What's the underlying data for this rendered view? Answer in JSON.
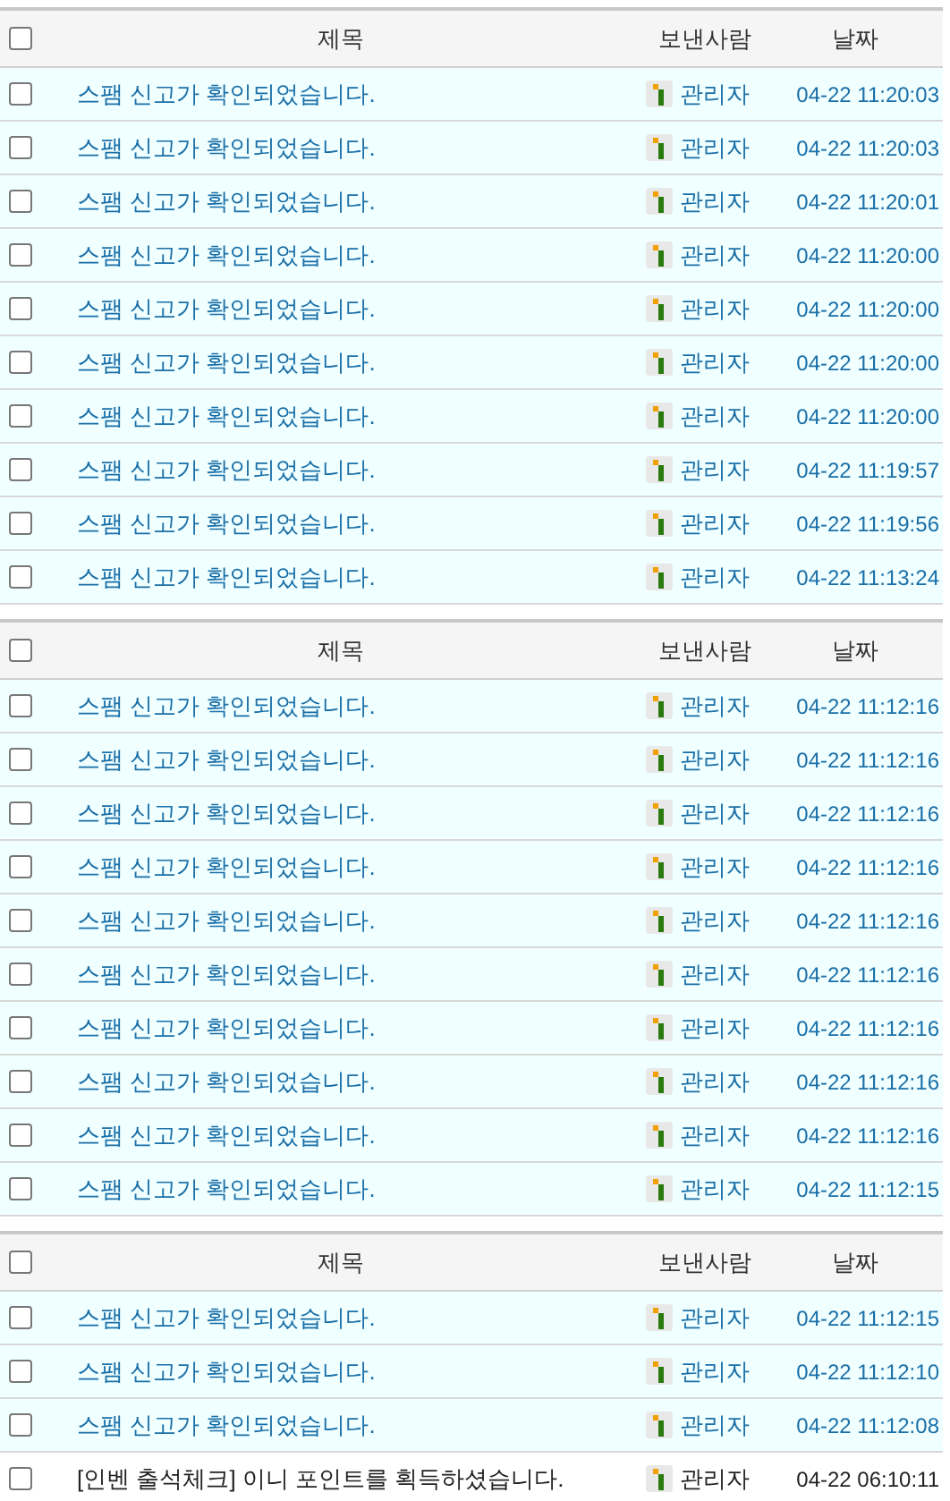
{
  "tables": [
    {
      "all_checked": false,
      "columns": [
        "제목",
        "보낸사람",
        "날짜"
      ],
      "rows": [
        {
          "subject": "스팸 신고가 확인되었습니다.",
          "sender": "관리자",
          "date": "04-22 11:20:03",
          "unread": true,
          "checked": false
        },
        {
          "subject": "스팸 신고가 확인되었습니다.",
          "sender": "관리자",
          "date": "04-22 11:20:03",
          "unread": true,
          "checked": false
        },
        {
          "subject": "스팸 신고가 확인되었습니다.",
          "sender": "관리자",
          "date": "04-22 11:20:01",
          "unread": true,
          "checked": false
        },
        {
          "subject": "스팸 신고가 확인되었습니다.",
          "sender": "관리자",
          "date": "04-22 11:20:00",
          "unread": true,
          "checked": false
        },
        {
          "subject": "스팸 신고가 확인되었습니다.",
          "sender": "관리자",
          "date": "04-22 11:20:00",
          "unread": true,
          "checked": false
        },
        {
          "subject": "스팸 신고가 확인되었습니다.",
          "sender": "관리자",
          "date": "04-22 11:20:00",
          "unread": true,
          "checked": false
        },
        {
          "subject": "스팸 신고가 확인되었습니다.",
          "sender": "관리자",
          "date": "04-22 11:20:00",
          "unread": true,
          "checked": false
        },
        {
          "subject": "스팸 신고가 확인되었습니다.",
          "sender": "관리자",
          "date": "04-22 11:19:57",
          "unread": true,
          "checked": false
        },
        {
          "subject": "스팸 신고가 확인되었습니다.",
          "sender": "관리자",
          "date": "04-22 11:19:56",
          "unread": true,
          "checked": false
        },
        {
          "subject": "스팸 신고가 확인되었습니다.",
          "sender": "관리자",
          "date": "04-22 11:13:24",
          "unread": true,
          "checked": false
        }
      ]
    },
    {
      "all_checked": false,
      "columns": [
        "제목",
        "보낸사람",
        "날짜"
      ],
      "rows": [
        {
          "subject": "스팸 신고가 확인되었습니다.",
          "sender": "관리자",
          "date": "04-22 11:12:16",
          "unread": true,
          "checked": false
        },
        {
          "subject": "스팸 신고가 확인되었습니다.",
          "sender": "관리자",
          "date": "04-22 11:12:16",
          "unread": true,
          "checked": false
        },
        {
          "subject": "스팸 신고가 확인되었습니다.",
          "sender": "관리자",
          "date": "04-22 11:12:16",
          "unread": true,
          "checked": false
        },
        {
          "subject": "스팸 신고가 확인되었습니다.",
          "sender": "관리자",
          "date": "04-22 11:12:16",
          "unread": true,
          "checked": false
        },
        {
          "subject": "스팸 신고가 확인되었습니다.",
          "sender": "관리자",
          "date": "04-22 11:12:16",
          "unread": true,
          "checked": false
        },
        {
          "subject": "스팸 신고가 확인되었습니다.",
          "sender": "관리자",
          "date": "04-22 11:12:16",
          "unread": true,
          "checked": false
        },
        {
          "subject": "스팸 신고가 확인되었습니다.",
          "sender": "관리자",
          "date": "04-22 11:12:16",
          "unread": true,
          "checked": false
        },
        {
          "subject": "스팸 신고가 확인되었습니다.",
          "sender": "관리자",
          "date": "04-22 11:12:16",
          "unread": true,
          "checked": false
        },
        {
          "subject": "스팸 신고가 확인되었습니다.",
          "sender": "관리자",
          "date": "04-22 11:12:16",
          "unread": true,
          "checked": false
        },
        {
          "subject": "스팸 신고가 확인되었습니다.",
          "sender": "관리자",
          "date": "04-22 11:12:15",
          "unread": true,
          "checked": false
        }
      ]
    },
    {
      "all_checked": false,
      "columns": [
        "제목",
        "보낸사람",
        "날짜"
      ],
      "rows": [
        {
          "subject": "스팸 신고가 확인되었습니다.",
          "sender": "관리자",
          "date": "04-22 11:12:15",
          "unread": true,
          "checked": false
        },
        {
          "subject": "스팸 신고가 확인되었습니다.",
          "sender": "관리자",
          "date": "04-22 11:12:10",
          "unread": true,
          "checked": false
        },
        {
          "subject": "스팸 신고가 확인되었습니다.",
          "sender": "관리자",
          "date": "04-22 11:12:08",
          "unread": true,
          "checked": false
        },
        {
          "subject": "[인벤 출석체크] 이니 포인트를 획득하셨습니다.",
          "sender": "관리자",
          "date": "04-22 06:10:11",
          "unread": false,
          "checked": false
        }
      ]
    }
  ]
}
